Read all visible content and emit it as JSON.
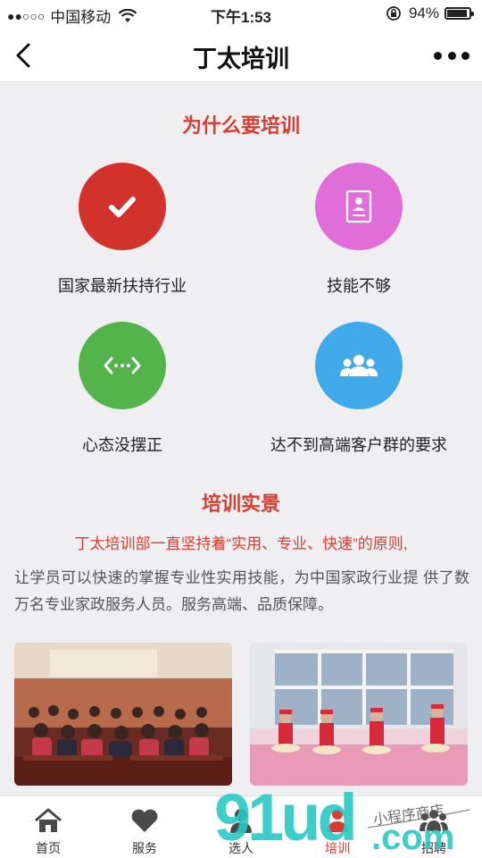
{
  "status": {
    "signal": "●●○○○",
    "carrier": "中国移动",
    "time": "下午1:53",
    "battery": "94%"
  },
  "nav": {
    "title": "丁太培训"
  },
  "why": {
    "title": "为什么要培训",
    "items": [
      {
        "label": "国家最新扶持行业",
        "icon": "check-icon",
        "color": "#d2322b"
      },
      {
        "label": "技能不够",
        "icon": "id-card-icon",
        "color": "#e06ed8"
      },
      {
        "label": "心态没摆正",
        "icon": "arrows-icon",
        "color": "#52b44a"
      },
      {
        "label": "达不到高端客户群的要求",
        "icon": "group-icon",
        "color": "#3fa9ea"
      }
    ]
  },
  "scene": {
    "title": "培训实景",
    "highlight": "丁太培训部一直坚持着“实用、专业、快速”的原则,",
    "body": "让学员可以快速的掌握专业性实用技能，为中国家政行业提 供了数万名专业家政服务人员。服务高端、品质保障。"
  },
  "tabs": [
    {
      "label": "首页",
      "icon": "home-icon"
    },
    {
      "label": "服务",
      "icon": "heart-icon"
    },
    {
      "label": "选人",
      "icon": "person-icon"
    },
    {
      "label": "培训",
      "icon": "training-icon"
    },
    {
      "label": "招聘",
      "icon": "recruit-icon"
    }
  ],
  "watermark": {
    "text": "91ud.com",
    "tagline": "小程序商店"
  },
  "colors": {
    "accent": "#d93d32",
    "watermark_cyan": "#29c9c5"
  }
}
